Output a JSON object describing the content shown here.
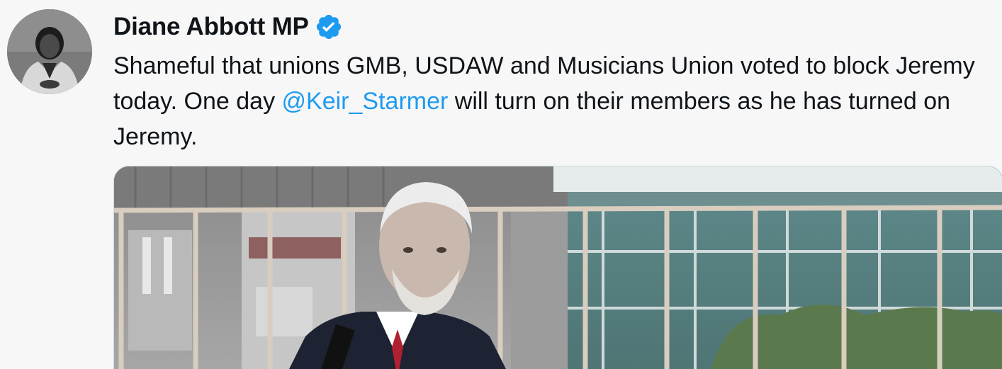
{
  "tweet": {
    "author": {
      "name": "Diane Abbott MP",
      "verified": true,
      "verified_icon": "verified-badge-icon"
    },
    "text": {
      "part1": "Shameful that unions GMB, USDAW and Musicians Union voted to block Jeremy today. One day ",
      "mention": "@Keir_Starmer",
      "part2": " will turn on their members as he has turned on Jeremy."
    },
    "colors": {
      "text": "#0f1419",
      "mention": "#1d9bf0",
      "verified": "#1d9bf0",
      "background": "#f7f7f7"
    }
  }
}
